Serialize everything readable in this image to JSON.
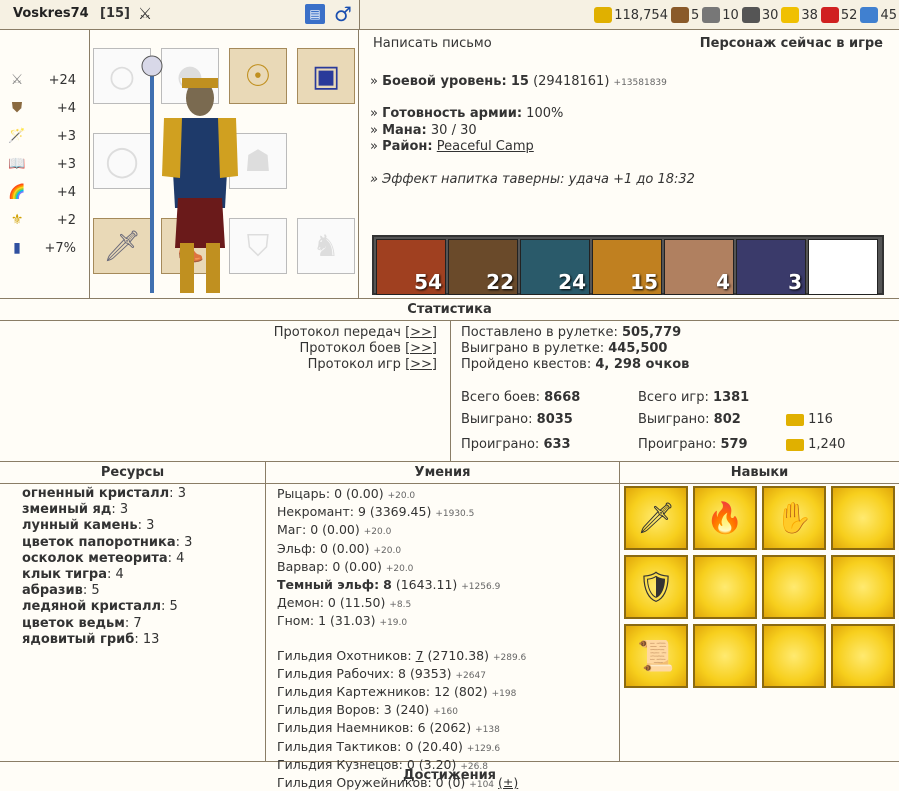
{
  "header": {
    "nick": "Voskres74",
    "level": "[15]",
    "resources": [
      {
        "icon": "gold-icon",
        "color": "#e0b000",
        "value": "118,754"
      },
      {
        "icon": "wood-icon",
        "color": "#8a5a2a",
        "value": "5"
      },
      {
        "icon": "ore-icon",
        "color": "#777777",
        "value": "10"
      },
      {
        "icon": "mercury-icon",
        "color": "#555555",
        "value": "30"
      },
      {
        "icon": "sulfur-icon",
        "color": "#f0c000",
        "value": "38"
      },
      {
        "icon": "crystal-icon",
        "color": "#d02020",
        "value": "52"
      },
      {
        "icon": "gems-icon",
        "color": "#4080d0",
        "value": "45"
      }
    ]
  },
  "stats": [
    {
      "icon": "attack-icon",
      "value": "+24"
    },
    {
      "icon": "defense-icon",
      "value": "+4"
    },
    {
      "icon": "magic-power-icon",
      "value": "+3"
    },
    {
      "icon": "knowledge-icon",
      "value": "+3"
    },
    {
      "icon": "luck-icon",
      "value": "+4"
    },
    {
      "icon": "morale-icon",
      "value": "+2"
    },
    {
      "icon": "initiative-icon",
      "value": "+7%"
    }
  ],
  "info": {
    "write_letter": "Написать письмо",
    "online_status": "Персонаж сейчас в игре",
    "combat_level_label": "Боевой уровень:",
    "combat_level_value": "15",
    "combat_exp": "(29418161)",
    "combat_exp_delta": "+13581839",
    "army_ready_label": "Готовность армии:",
    "army_ready_value": "100%",
    "mana_label": "Мана:",
    "mana_value": "30 / 30",
    "district_label": "Район:",
    "district_value": "Peaceful Camp",
    "tavern_effect": "Эффект напитка таверны: удача +1 до 18:32"
  },
  "army": [
    {
      "count": "54",
      "color": "#a04020"
    },
    {
      "count": "22",
      "color": "#6a4a2a"
    },
    {
      "count": "24",
      "color": "#2a5a6a"
    },
    {
      "count": "15",
      "color": "#c08020"
    },
    {
      "count": "4",
      "color": "#b08060"
    },
    {
      "count": "3",
      "color": "#3a3a6a"
    },
    {
      "count": "",
      "color": "#ffffff"
    }
  ],
  "statistics": {
    "title": "Статистика",
    "protocols": [
      {
        "label": "Протокол передач",
        "link": "[>>]"
      },
      {
        "label": "Протокол боев",
        "link": "[>>]"
      },
      {
        "label": "Протокол игр",
        "link": "[>>]"
      }
    ],
    "roulette_bet_label": "Поставлено в рулетке:",
    "roulette_bet_value": "505,779",
    "roulette_won_label": "Выиграно в рулетке:",
    "roulette_won_value": "445,500",
    "quests_label": "Пройдено квестов:",
    "quests_value": "4, 298 очков",
    "battles_total_label": "Всего боев:",
    "battles_total_value": "8668",
    "battles_won_label": "Выиграно:",
    "battles_won_value": "8035",
    "battles_lost_label": "Проиграно:",
    "battles_lost_value": "633",
    "games_total_label": "Всего игр:",
    "games_total_value": "1381",
    "games_won_label": "Выиграно:",
    "games_won_value": "802",
    "games_won_gold": "116",
    "games_lost_label": "Проиграно:",
    "games_lost_value": "579",
    "games_lost_gold": "1,240"
  },
  "resources_section": {
    "title": "Ресурсы",
    "items": [
      {
        "name": "огненный кристалл",
        "qty": "3"
      },
      {
        "name": "змеиный яд",
        "qty": "3"
      },
      {
        "name": "лунный камень",
        "qty": "3"
      },
      {
        "name": "цветок папоротника",
        "qty": "3"
      },
      {
        "name": "осколок метеорита",
        "qty": "4"
      },
      {
        "name": "клык тигра",
        "qty": "4"
      },
      {
        "name": "абразив",
        "qty": "5"
      },
      {
        "name": "ледяной кристалл",
        "qty": "5"
      },
      {
        "name": "цветок ведьм",
        "qty": "7"
      },
      {
        "name": "ядовитый гриб",
        "qty": "13"
      }
    ]
  },
  "skills_section": {
    "title": "Умения",
    "factions": [
      {
        "name": "Рыцарь:",
        "value": "0 (0.00)",
        "delta": "+20.0",
        "bold": false
      },
      {
        "name": "Некромант:",
        "value": "9 (3369.45)",
        "delta": "+1930.5",
        "bold": false
      },
      {
        "name": "Маг:",
        "value": "0 (0.00)",
        "delta": "+20.0",
        "bold": false
      },
      {
        "name": "Эльф:",
        "value": "0 (0.00)",
        "delta": "+20.0",
        "bold": false
      },
      {
        "name": "Варвар:",
        "value": "0 (0.00)",
        "delta": "+20.0",
        "bold": false
      },
      {
        "name": "Темный эльф:",
        "value": "8",
        "value2": "(1643.11)",
        "delta": "+1256.9",
        "bold": true
      },
      {
        "name": "Демон:",
        "value": "0 (11.50)",
        "delta": "+8.5",
        "bold": false
      },
      {
        "name": "Гном:",
        "value": "1 (31.03)",
        "delta": "+19.0",
        "bold": false
      }
    ],
    "guilds": [
      {
        "name": "Гильдия Охотников:",
        "value": "7",
        "value2": "(2710.38)",
        "delta": "+289.6"
      },
      {
        "name": "Гильдия Рабочих:",
        "value": "8 (9353)",
        "delta": "+2647"
      },
      {
        "name": "Гильдия Картежников:",
        "value": "12 (802)",
        "delta": "+198"
      },
      {
        "name": "Гильдия Воров:",
        "value": "3 (240)",
        "delta": "+160"
      },
      {
        "name": "Гильдия Наемников:",
        "value": "6 (2062)",
        "delta": "+138"
      },
      {
        "name": "Гильдия Тактиков:",
        "value": "0 (20.40)",
        "delta": "+129.6"
      },
      {
        "name": "Гильдия Кузнецов:",
        "value": "0 (3.20)",
        "delta": "+26.8"
      },
      {
        "name": "Гильдия Оружейников:",
        "value": "0 (0)",
        "delta": "+104",
        "extra": "(±)"
      }
    ]
  },
  "perks_section": {
    "title": "Навыки",
    "cells": [
      {
        "icon": "sword-perk-icon",
        "glyph": "🗡"
      },
      {
        "icon": "fire-head-perk-icon",
        "glyph": "🔥"
      },
      {
        "icon": "hand-perk-icon",
        "glyph": "✋"
      },
      {
        "icon": "",
        "glyph": ""
      },
      {
        "icon": "shield-face-perk-icon",
        "glyph": "🛡"
      },
      {
        "icon": "",
        "glyph": ""
      },
      {
        "icon": "",
        "glyph": ""
      },
      {
        "icon": "",
        "glyph": ""
      },
      {
        "icon": "scroll-perk-icon",
        "glyph": "📜"
      },
      {
        "icon": "",
        "glyph": ""
      },
      {
        "icon": "",
        "glyph": ""
      },
      {
        "icon": "",
        "glyph": ""
      }
    ]
  },
  "achievements": {
    "title": "Достижения"
  }
}
